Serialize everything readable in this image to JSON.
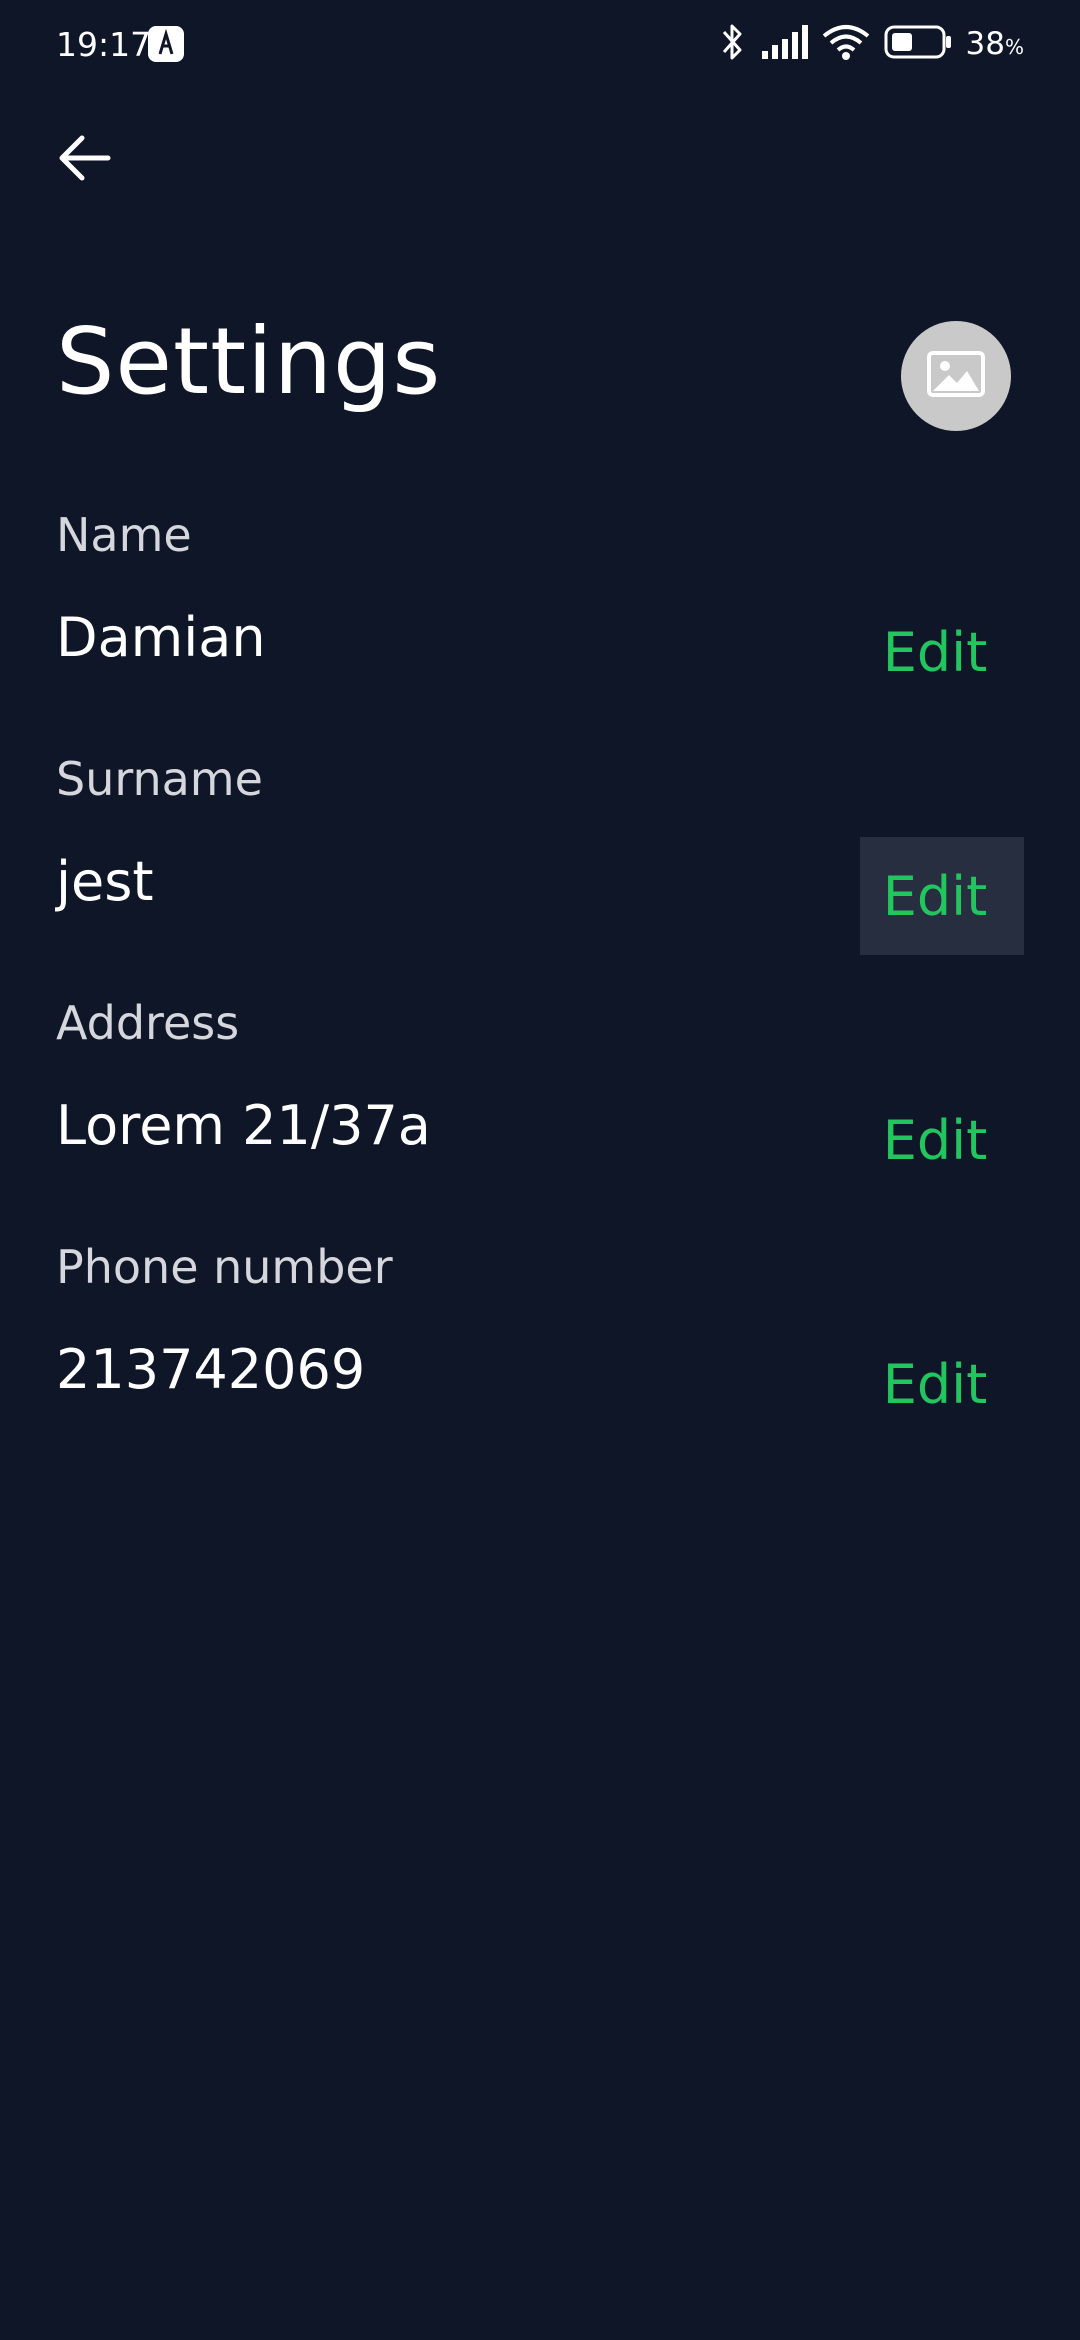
{
  "status_bar": {
    "time": "19:17",
    "battery_percent": "38",
    "battery_unit": "%",
    "icons": [
      "app-notification-icon",
      "bluetooth-icon",
      "signal-icon",
      "wifi-icon",
      "battery-icon"
    ]
  },
  "header": {
    "back_icon": "arrow-left-icon",
    "title": "Settings",
    "avatar_icon": "image-placeholder-icon"
  },
  "fields": [
    {
      "label": "Name",
      "value": "Damian",
      "edit_label": "Edit"
    },
    {
      "label": "Surname",
      "value": "jest",
      "edit_label": "Edit"
    },
    {
      "label": "Address",
      "value": "Lorem 21/37a",
      "edit_label": "Edit"
    },
    {
      "label": "Phone number",
      "value": "213742069",
      "edit_label": "Edit"
    }
  ],
  "colors": {
    "background": "#0f1628",
    "accent": "#22c55e",
    "label": "#d5d7dc",
    "pressed_highlight": "#262e40",
    "avatar_bg": "#c9c9c9"
  }
}
